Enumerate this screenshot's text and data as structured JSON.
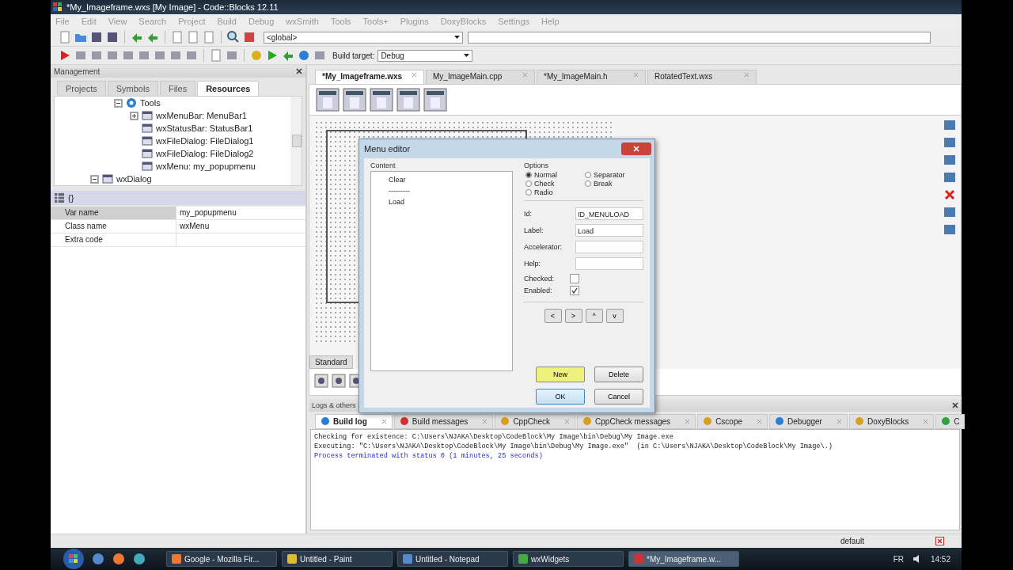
{
  "window": {
    "title": "*My_Imageframe.wxs [My Image] - Code::Blocks 12.11"
  },
  "menu": [
    "File",
    "Edit",
    "View",
    "Search",
    "Project",
    "Build",
    "Debug",
    "wxSmith",
    "Tools",
    "Tools+",
    "Plugins",
    "DoxyBlocks",
    "Settings",
    "Help"
  ],
  "toolbar": {
    "scope": "<global>",
    "build_target_label": "Build target:",
    "build_target": "Debug"
  },
  "management": {
    "title": "Management",
    "tabs": [
      {
        "label": "Projects",
        "selected": false
      },
      {
        "label": "Symbols",
        "selected": false
      },
      {
        "label": "Files",
        "selected": false
      },
      {
        "label": "Resources",
        "selected": true
      }
    ],
    "tree": [
      {
        "label": "Tools",
        "expanded": true,
        "children": [
          {
            "label": "wxMenuBar: MenuBar1",
            "expanded": false
          },
          {
            "label": "wxStatusBar: StatusBar1"
          },
          {
            "label": "wxFileDialog: FileDialog1"
          },
          {
            "label": "wxFileDialog: FileDialog2"
          },
          {
            "label": "wxMenu: my_popupmenu"
          }
        ]
      },
      {
        "label": "wxDialog",
        "expanded": true
      }
    ],
    "properties_tab": "{}",
    "properties": [
      {
        "name": "Var name",
        "value": "my_popupmenu",
        "selected": true
      },
      {
        "name": "Class name",
        "value": "wxMenu",
        "selected": false
      },
      {
        "name": "Extra code",
        "selected": false
      }
    ]
  },
  "editor_tabs": [
    {
      "label": "*My_Imageframe.wxs",
      "selected": true
    },
    {
      "label": "My_ImageMain.cpp",
      "selected": false
    },
    {
      "label": "*My_ImageMain.h",
      "selected": false
    },
    {
      "label": "RotatedText.wxs",
      "selected": false
    }
  ],
  "palette": {
    "tab": "Standard"
  },
  "menu_editor": {
    "title": "Menu editor",
    "content_label": "Content",
    "items": [
      "Clear",
      "---------",
      "Load"
    ],
    "options_label": "Options",
    "options": [
      {
        "label": "Normal",
        "selected": true
      },
      {
        "label": "Check",
        "selected": false
      },
      {
        "label": "Radio",
        "selected": false
      },
      {
        "label": "Separator",
        "selected": false
      },
      {
        "label": "Break",
        "selected": false
      }
    ],
    "fields": [
      {
        "label": "Id:",
        "value": "ID_MENULOAD"
      },
      {
        "label": "Label:",
        "value": "Load"
      },
      {
        "label": "Accelerator:"
      },
      {
        "label": "Help:"
      }
    ],
    "checks": [
      {
        "label": "Checked:",
        "checked": false
      },
      {
        "label": "Enabled:",
        "checked": true
      }
    ],
    "move_buttons": [
      "<",
      ">",
      "^",
      "v"
    ],
    "buttons": [
      {
        "label": "New",
        "kind": "highlight"
      },
      {
        "label": "Delete",
        "kind": "plain"
      },
      {
        "label": "OK",
        "kind": "default"
      },
      {
        "label": "Cancel",
        "kind": "plain"
      }
    ]
  },
  "logs": {
    "title": "Logs & others",
    "tabs": [
      {
        "label": "Build log",
        "selected": true
      },
      {
        "label": "Build messages",
        "selected": false
      },
      {
        "label": "CppCheck",
        "selected": false
      },
      {
        "label": "CppCheck messages",
        "selected": false
      },
      {
        "label": "Cscope",
        "selected": false
      },
      {
        "label": "Debugger",
        "selected": false
      },
      {
        "label": "DoxyBlocks",
        "selected": false
      },
      {
        "label": "C",
        "selected": false
      }
    ],
    "lines": [
      {
        "text": "Checking for existence: C:\\Users\\NJAKA\\Desktop\\CodeBlock\\My Image\\bin\\Debug\\My Image.exe",
        "kind": "normal"
      },
      {
        "text": "Executing: \"C:\\Users\\NJAKA\\Desktop\\CodeBlock\\My Image\\bin\\Debug\\My Image.exe\"  (in C:\\Users\\NJAKA\\Desktop\\CodeBlock\\My Image\\.)",
        "kind": "normal"
      },
      {
        "text": "Process terminated with status 0 (1 minutes, 25 seconds)",
        "kind": "info"
      }
    ]
  },
  "status_bar": {
    "profile": "default"
  },
  "taskbar": {
    "windows": [
      {
        "label": "Google - Mozilla Fir...",
        "selected": false
      },
      {
        "label": "Untitled - Paint",
        "selected": false
      },
      {
        "label": "Untitled - Notepad",
        "selected": false
      },
      {
        "label": "wxWidgets",
        "selected": false
      },
      {
        "label": "*My_Imageframe.w...",
        "selected": true
      }
    ],
    "language": "FR",
    "clock": "14:52"
  }
}
